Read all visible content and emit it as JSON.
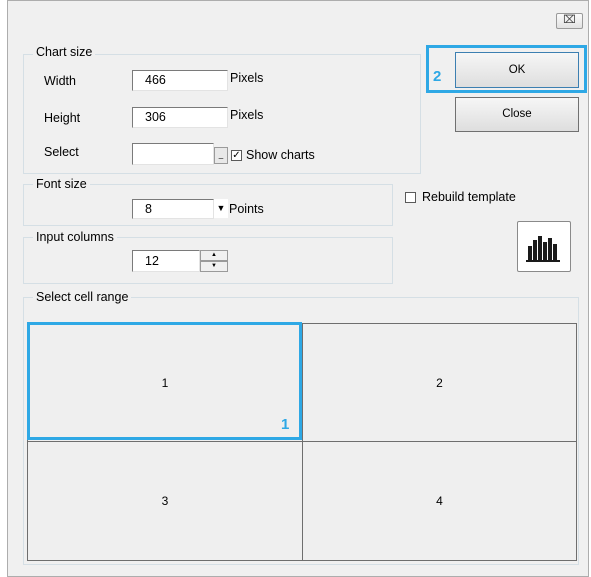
{
  "title_bar": {
    "close_glyph": "⌧"
  },
  "chart_size": {
    "legend": "Chart size",
    "width_label": "Width",
    "width_value": "466",
    "width_unit": "Pixels",
    "height_label": "Height",
    "height_value": "306",
    "height_unit": "Pixels",
    "select_label": "Select",
    "select_value": "",
    "dropdown_glyph": "_",
    "show_charts_label": "Show charts",
    "show_charts_checked": true,
    "check_glyph": "✓"
  },
  "font_size": {
    "legend": "Font size",
    "value": "8",
    "dropdown_glyph": "▼",
    "unit": "Points"
  },
  "input_columns": {
    "legend": "Input columns",
    "value": "12",
    "spin_up": "▲",
    "spin_down": "▼"
  },
  "buttons": {
    "ok_label": "OK",
    "close_label": "Close"
  },
  "rebuild_template": {
    "label": "Rebuild template",
    "checked": false
  },
  "chart_icon_name": "bar-chart-icon",
  "cell_range": {
    "legend": "Select cell range",
    "cells": [
      "1",
      "2",
      "3",
      "4"
    ]
  },
  "callouts": {
    "ok_marker": "2",
    "cell_marker": "1",
    "color": "#2ea8e5"
  }
}
